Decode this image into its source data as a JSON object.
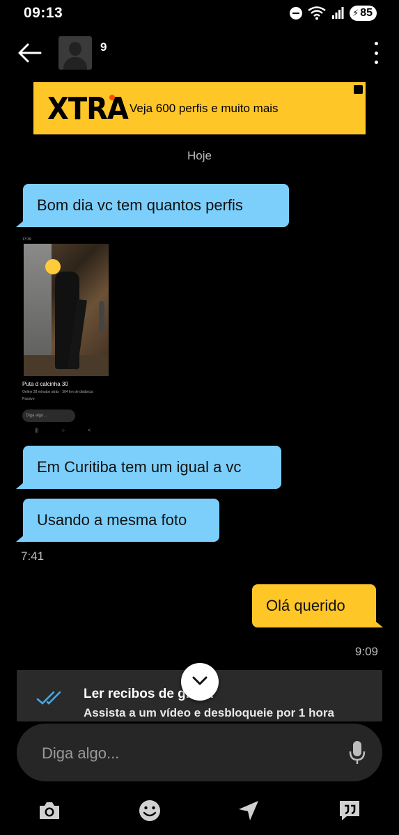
{
  "status_bar": {
    "time": "09:13",
    "battery": "85"
  },
  "header": {
    "contact_name": "9"
  },
  "banner": {
    "logo": "XTRA",
    "text": "Veja 600 perfis e muito mais"
  },
  "date_separator": "Hoje",
  "messages": [
    {
      "direction": "in",
      "text": "Bom dia vc tem quantos perfis"
    },
    {
      "direction": "in",
      "type": "image"
    },
    {
      "direction": "in",
      "text": "Em Curitiba tem um igual a vc"
    },
    {
      "direction": "in",
      "text": "Usando a mesma foto"
    },
    {
      "direction": "out",
      "text": "Olá querido"
    }
  ],
  "times": {
    "incoming": "7:41",
    "outgoing": "9:09"
  },
  "photo": {
    "status": "17:39",
    "name": "Puta d calcinha  30",
    "sub": "Online 28 minutos atrás  ·  304 km de distância",
    "sub2": "Passivo",
    "input": "Diga algo..."
  },
  "upsell": {
    "title": "Ler recibos de graça",
    "subtitle": "Assista a um vídeo e desbloqueie por 1 hora"
  },
  "input": {
    "placeholder": "Diga algo..."
  },
  "colors": {
    "incoming_bubble": "#7ccffb",
    "outgoing_bubble": "#ffc628",
    "banner": "#ffc628"
  },
  "toolbar_icons": [
    "camera-icon",
    "emoji-icon",
    "location-icon",
    "phrases-icon"
  ]
}
